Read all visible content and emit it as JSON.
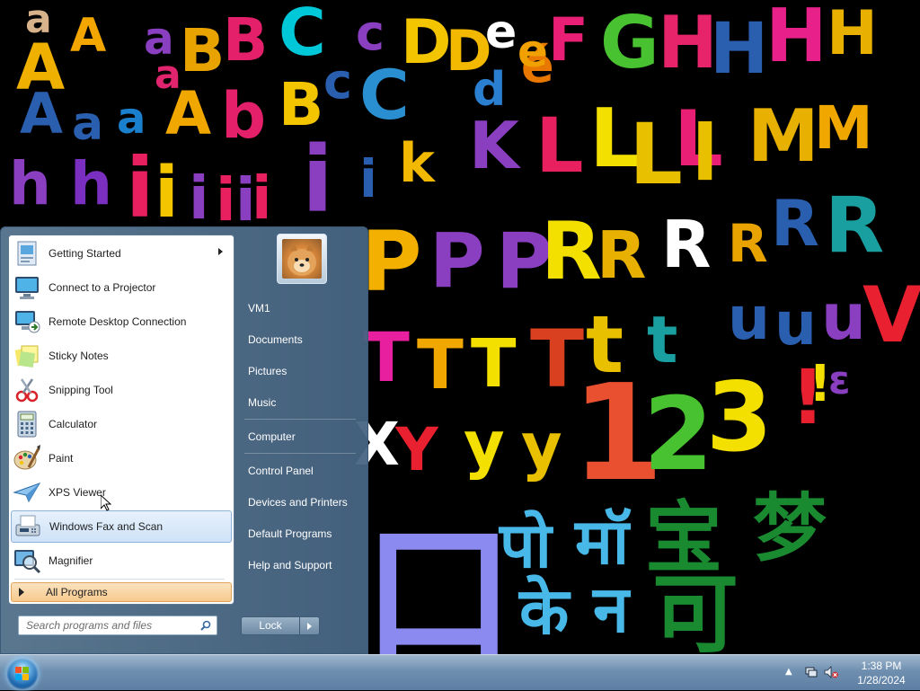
{
  "wallpaper": {
    "letters": [
      {
        "t": "a",
        "c": "#d8b28a"
      },
      {
        "t": "A",
        "c": "#f0b000"
      },
      {
        "t": "A",
        "c": "#f3a600"
      },
      {
        "t": "a",
        "c": "#8a3fc0"
      },
      {
        "t": "a",
        "c": "#e0256e"
      },
      {
        "t": "B",
        "c": "#e8a300"
      },
      {
        "t": "B",
        "c": "#e4206a"
      },
      {
        "t": "C",
        "c": "#00c8d8"
      },
      {
        "t": "c",
        "c": "#8a3fc0"
      },
      {
        "t": "D",
        "c": "#f3c400"
      },
      {
        "t": "D",
        "c": "#f3b800"
      },
      {
        "t": "e",
        "c": "#ffffff"
      },
      {
        "t": "é",
        "c": "#e87800"
      },
      {
        "t": "F",
        "c": "#e81f74"
      },
      {
        "t": "G",
        "c": "#48c230"
      },
      {
        "t": "H",
        "c": "#e7246a"
      },
      {
        "t": "H",
        "c": "#2a5fb0"
      },
      {
        "t": "H",
        "c": "#e8208a"
      },
      {
        "t": "H",
        "c": "#e8b000"
      },
      {
        "t": "A",
        "c": "#2a5fb0"
      },
      {
        "t": "a",
        "c": "#2a5fb0"
      },
      {
        "t": "a",
        "c": "#1a7fcc"
      },
      {
        "t": "A",
        "c": "#f0a800"
      },
      {
        "t": "b",
        "c": "#e4206a"
      },
      {
        "t": "B",
        "c": "#f3c400"
      },
      {
        "t": "c",
        "c": "#2a5fb0"
      },
      {
        "t": "C",
        "c": "#2a8fd0"
      },
      {
        "t": "d",
        "c": "#2a7fd0"
      },
      {
        "t": "e",
        "c": "#f0a000"
      },
      {
        "t": "k",
        "c": "#f3b800"
      },
      {
        "t": "K",
        "c": "#8a3fc0"
      },
      {
        "t": "L",
        "c": "#e82060"
      },
      {
        "t": "L",
        "c": "#f3e000"
      },
      {
        "t": "L",
        "c": "#e8c000"
      },
      {
        "t": "L",
        "c": "#e81f74"
      },
      {
        "t": "l",
        "c": "#e8c000"
      },
      {
        "t": "M",
        "c": "#e8b000"
      },
      {
        "t": "M",
        "c": "#f0a800"
      },
      {
        "t": "h",
        "c": "#8a3fc0"
      },
      {
        "t": "h",
        "c": "#7a2fc0"
      },
      {
        "t": "i",
        "c": "#e82060"
      },
      {
        "t": "i",
        "c": "#f3c400"
      },
      {
        "t": "i",
        "c": "#8a3fc0"
      },
      {
        "t": "i",
        "c": "#e82060"
      },
      {
        "t": "i",
        "c": "#8a3fc0"
      },
      {
        "t": "i",
        "c": "#e82060"
      },
      {
        "t": "i",
        "c": "#8a3fc0"
      },
      {
        "t": "i",
        "c": "#2a5fb0"
      },
      {
        "t": "P",
        "c": "#f3b000"
      },
      {
        "t": "P",
        "c": "#8a3fc0"
      },
      {
        "t": "P",
        "c": "#8a3fc0"
      },
      {
        "t": "R",
        "c": "#f3e000"
      },
      {
        "t": "R",
        "c": "#e8b000"
      },
      {
        "t": "R",
        "c": "#ffffff"
      },
      {
        "t": "R",
        "c": "#e8a300"
      },
      {
        "t": "R",
        "c": "#2a5fb0"
      },
      {
        "t": "R",
        "c": "#1a9fa0"
      },
      {
        "t": "T",
        "c": "#e820a0"
      },
      {
        "t": "T",
        "c": "#f0a800"
      },
      {
        "t": "T",
        "c": "#f3e000"
      },
      {
        "t": "T",
        "c": "#d84020"
      },
      {
        "t": "t",
        "c": "#e8c000"
      },
      {
        "t": "t",
        "c": "#1a9fa0"
      },
      {
        "t": "u",
        "c": "#2a5fb0"
      },
      {
        "t": "u",
        "c": "#2a5fb0"
      },
      {
        "t": "u",
        "c": "#8a3fc0"
      },
      {
        "t": "V",
        "c": "#e82030"
      },
      {
        "t": "X",
        "c": "#ffffff"
      },
      {
        "t": "Y",
        "c": "#e82030"
      },
      {
        "t": "y",
        "c": "#f3e000"
      },
      {
        "t": "y",
        "c": "#e8c000"
      },
      {
        "t": "1",
        "c": "#e85030"
      },
      {
        "t": "2",
        "c": "#48c230"
      },
      {
        "t": "3",
        "c": "#f3e000"
      },
      {
        "t": "!",
        "c": "#e82030"
      },
      {
        "t": "!",
        "c": "#f3e000"
      },
      {
        "t": "ε",
        "c": "#8a3fc0"
      },
      {
        "t": "पो",
        "c": "#48b8e8"
      },
      {
        "t": "मॉ",
        "c": "#48b8e8"
      },
      {
        "t": "宝",
        "c": "#1a8a30"
      },
      {
        "t": "梦",
        "c": "#1a8a30"
      },
      {
        "t": "के",
        "c": "#48b8e8"
      },
      {
        "t": "न",
        "c": "#48b8e8"
      },
      {
        "t": "可",
        "c": "#1a8a30"
      },
      {
        "t": "口",
        "c": "#8a8af0"
      }
    ]
  },
  "start_menu": {
    "programs": [
      {
        "label": "Getting Started",
        "icon": "getting-started-icon",
        "has_submenu": true
      },
      {
        "label": "Connect to a Projector",
        "icon": "projector-icon",
        "has_submenu": false
      },
      {
        "label": "Remote Desktop Connection",
        "icon": "remote-desktop-icon",
        "has_submenu": false
      },
      {
        "label": "Sticky Notes",
        "icon": "sticky-notes-icon",
        "has_submenu": false
      },
      {
        "label": "Snipping Tool",
        "icon": "snipping-tool-icon",
        "has_submenu": false
      },
      {
        "label": "Calculator",
        "icon": "calculator-icon",
        "has_submenu": false
      },
      {
        "label": "Paint",
        "icon": "paint-icon",
        "has_submenu": false
      },
      {
        "label": "XPS Viewer",
        "icon": "xps-viewer-icon",
        "has_submenu": false
      },
      {
        "label": "Windows Fax and Scan",
        "icon": "fax-scan-icon",
        "has_submenu": false,
        "selected": true
      },
      {
        "label": "Magnifier",
        "icon": "magnifier-icon",
        "has_submenu": false
      }
    ],
    "all_programs_label": "All Programs",
    "search_placeholder": "Search programs and files",
    "right_links": [
      {
        "label": "VM1"
      },
      {
        "label": "Documents"
      },
      {
        "label": "Pictures"
      },
      {
        "label": "Music"
      },
      {
        "label": "Computer"
      },
      {
        "label": "Control Panel"
      },
      {
        "label": "Devices and Printers"
      },
      {
        "label": "Default Programs"
      },
      {
        "label": "Help and Support"
      }
    ],
    "lock_label": "Lock"
  },
  "taskbar": {
    "time": "1:38 PM",
    "date": "1/28/2024"
  },
  "colors": {
    "accent": "#5d7fa3",
    "selected_item_bg": "#cfe2f7",
    "all_programs_bg": "#f6c98c"
  }
}
